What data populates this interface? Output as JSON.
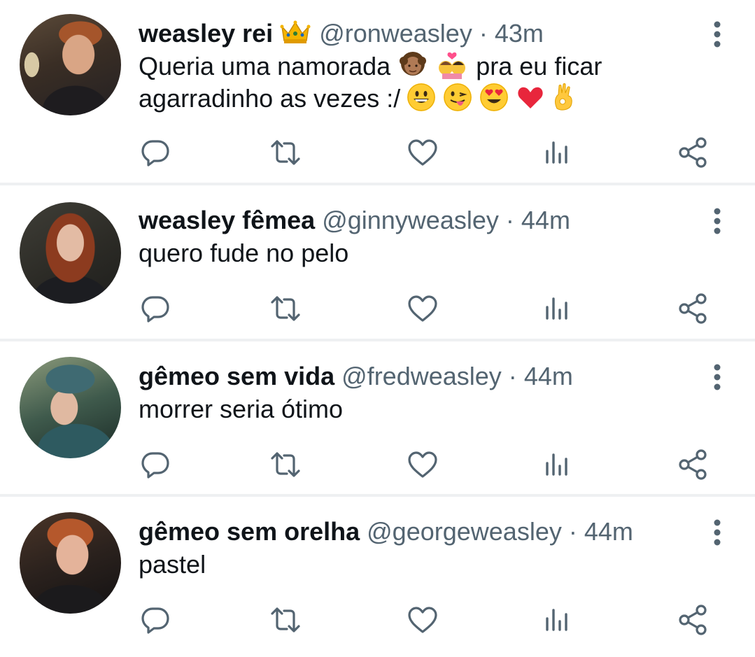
{
  "tweets": [
    {
      "avatar": "ron-weasley-avatar",
      "name": "weasley rei",
      "name_emoji": "crown-emoji",
      "handle": "@ronweasley",
      "dot": "·",
      "time": "43m",
      "lines": [
        "Queria uma namorada",
        "pra eu ficar",
        "agarradinho as vezes :/"
      ],
      "emojis_line1": [
        "girl-emoji",
        "kiss-couple-emoji"
      ],
      "emojis_line2": [
        "grinning-face-emoji",
        "winking-tongue-emoji",
        "heart-eyes-emoji",
        "red-heart-emoji",
        "ok-hand-emoji"
      ]
    },
    {
      "avatar": "ginny-weasley-avatar",
      "name": "weasley fêmea",
      "handle": "@ginnyweasley",
      "dot": "·",
      "time": "44m",
      "text": "quero fude no pelo"
    },
    {
      "avatar": "fred-weasley-avatar",
      "name": "gêmeo sem vida",
      "handle": "@fredweasley",
      "dot": "·",
      "time": "44m",
      "text": "morrer seria ótimo"
    },
    {
      "avatar": "george-weasley-avatar",
      "name": "gêmeo sem orelha",
      "handle": "@georgeweasley",
      "dot": "·",
      "time": "44m",
      "text": "pastel"
    }
  ],
  "colors": {
    "text": "#0f1419",
    "secondary": "#536471",
    "divider": "#eef0f2",
    "icon": "#536471"
  },
  "icons": {
    "reply": "reply-icon",
    "retweet": "retweet-icon",
    "like": "heart-icon",
    "views": "views-icon",
    "share": "share-icon",
    "more": "more-vertical-icon"
  }
}
